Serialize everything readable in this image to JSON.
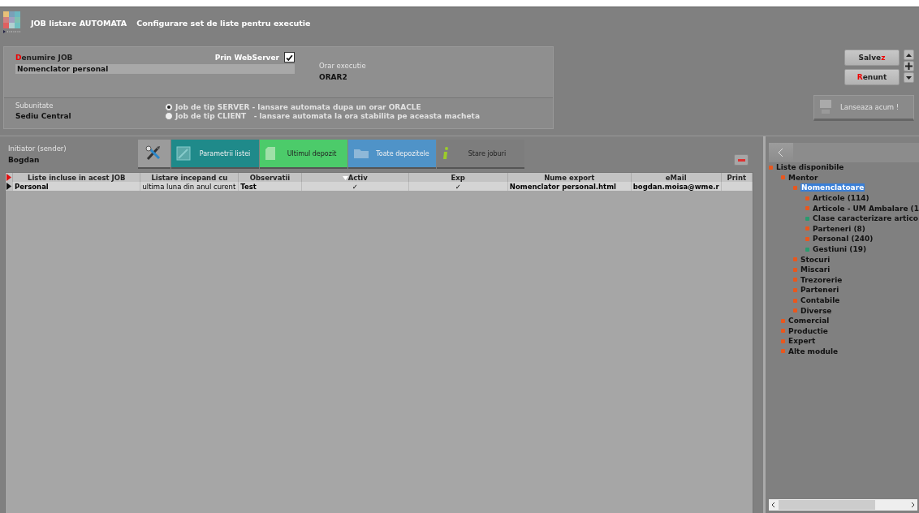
{
  "window": {
    "title": "JOB listare AUTOMATA",
    "subtitle": "Configurare set de liste pentru executie"
  },
  "job": {
    "name_label": [
      {
        "text": "D",
        "hotkey": true
      },
      {
        "text": "enumire JOB",
        "hotkey": false
      }
    ],
    "name_value": "Nomenclator personal",
    "webserver_label": "Prin WebServer",
    "webserver_checked": true,
    "schedule_label": "Orar executie",
    "schedule_value": "ORAR2"
  },
  "subunit": {
    "label": "Subunitate",
    "value": "Sediu Central"
  },
  "job_type": [
    {
      "label": "Job de tip SERVER - lansare automata dupa un orar ORACLE",
      "selected": true
    },
    {
      "label": "Job de tip CLIENT   - lansare automata la ora stabilita pe aceasta macheta",
      "selected": false
    }
  ],
  "actions": [
    {
      "label": [
        {
          "text": "Salve",
          "hotkey": false
        },
        {
          "text": "z",
          "hotkey": true
        }
      ]
    },
    {
      "label": [
        {
          "text": "R",
          "hotkey": true
        },
        {
          "text": "enunt",
          "hotkey": false
        }
      ]
    }
  ],
  "launch_button": {
    "label": "Lanseaza acum !",
    "disabled": true
  },
  "initiator": {
    "label": "Initiator (sender)",
    "value": "Bogdan"
  },
  "toolbar": [
    {
      "kind": "tools"
    },
    {
      "kind": "params",
      "label": "Parametrii listei",
      "color": "#1f8a8a",
      "disabled": true
    },
    {
      "kind": "page",
      "label": "Ultimul depozit",
      "color": "#4ccb6a",
      "disabled": false
    },
    {
      "kind": "folder",
      "label": "Toate depozitele",
      "color": "#4f93c8",
      "disabled": true
    },
    {
      "kind": "info",
      "label": "Stare joburi",
      "color": "#7d7d7d",
      "disabled": false
    }
  ],
  "table": {
    "columns": [
      {
        "label": "Liste incluse in acest JOB",
        "sorted": false
      },
      {
        "label": "Listare incepand cu",
        "sorted": false
      },
      {
        "label": "Observatii",
        "sorted": false
      },
      {
        "label": "Activ",
        "sorted": true
      },
      {
        "label": "Exp",
        "sorted": false
      },
      {
        "label": "Nume export",
        "sorted": false
      },
      {
        "label": "eMail",
        "sorted": false
      },
      {
        "label": "Print",
        "sorted": false
      }
    ],
    "rows": [
      {
        "selected": true,
        "cells": [
          "Personal",
          "ultima luna din anul curent",
          "Test",
          "✓",
          "✓",
          "Nomenclator personal.html",
          "bogdan.moisa@wme.r",
          ""
        ]
      }
    ]
  },
  "tree": [
    {
      "label": "Liste disponibile",
      "color": "#e8571e",
      "selected": false,
      "children": [
        {
          "label": "Mentor",
          "color": "#e8571e",
          "selected": false,
          "children": [
            {
              "label": "Nomenclatoare",
              "color": "#e8571e",
              "selected": true,
              "children": [
                {
                  "label": "Articole (114)",
                  "color": "#e8571e",
                  "selected": false
                },
                {
                  "label": "Articole - UM Ambalare (1",
                  "color": "#e8571e",
                  "selected": false
                },
                {
                  "label": "Clase caracterizare artico",
                  "color": "#2a9a6e",
                  "selected": false
                },
                {
                  "label": "Parteneri (8)",
                  "color": "#e8571e",
                  "selected": false
                },
                {
                  "label": "Personal (240)",
                  "color": "#e8571e",
                  "selected": false
                },
                {
                  "label": "Gestiuni (19)",
                  "color": "#2a9a6e",
                  "selected": false
                }
              ]
            },
            {
              "label": "Stocuri",
              "color": "#e8571e",
              "selected": false
            },
            {
              "label": "Miscari",
              "color": "#e8571e",
              "selected": false
            },
            {
              "label": "Trezorerie",
              "color": "#e8571e",
              "selected": false
            },
            {
              "label": "Parteneri",
              "color": "#e8571e",
              "selected": false
            },
            {
              "label": "Contabile",
              "color": "#e8571e",
              "selected": false
            },
            {
              "label": "Diverse",
              "color": "#e8571e",
              "selected": false
            }
          ]
        },
        {
          "label": "Comercial",
          "color": "#e8571e",
          "selected": false
        },
        {
          "label": "Productie",
          "color": "#e8571e",
          "selected": false
        },
        {
          "label": "Expert",
          "color": "#e8571e",
          "selected": false
        },
        {
          "label": "Alte module",
          "color": "#e8571e",
          "selected": false
        }
      ]
    }
  ]
}
